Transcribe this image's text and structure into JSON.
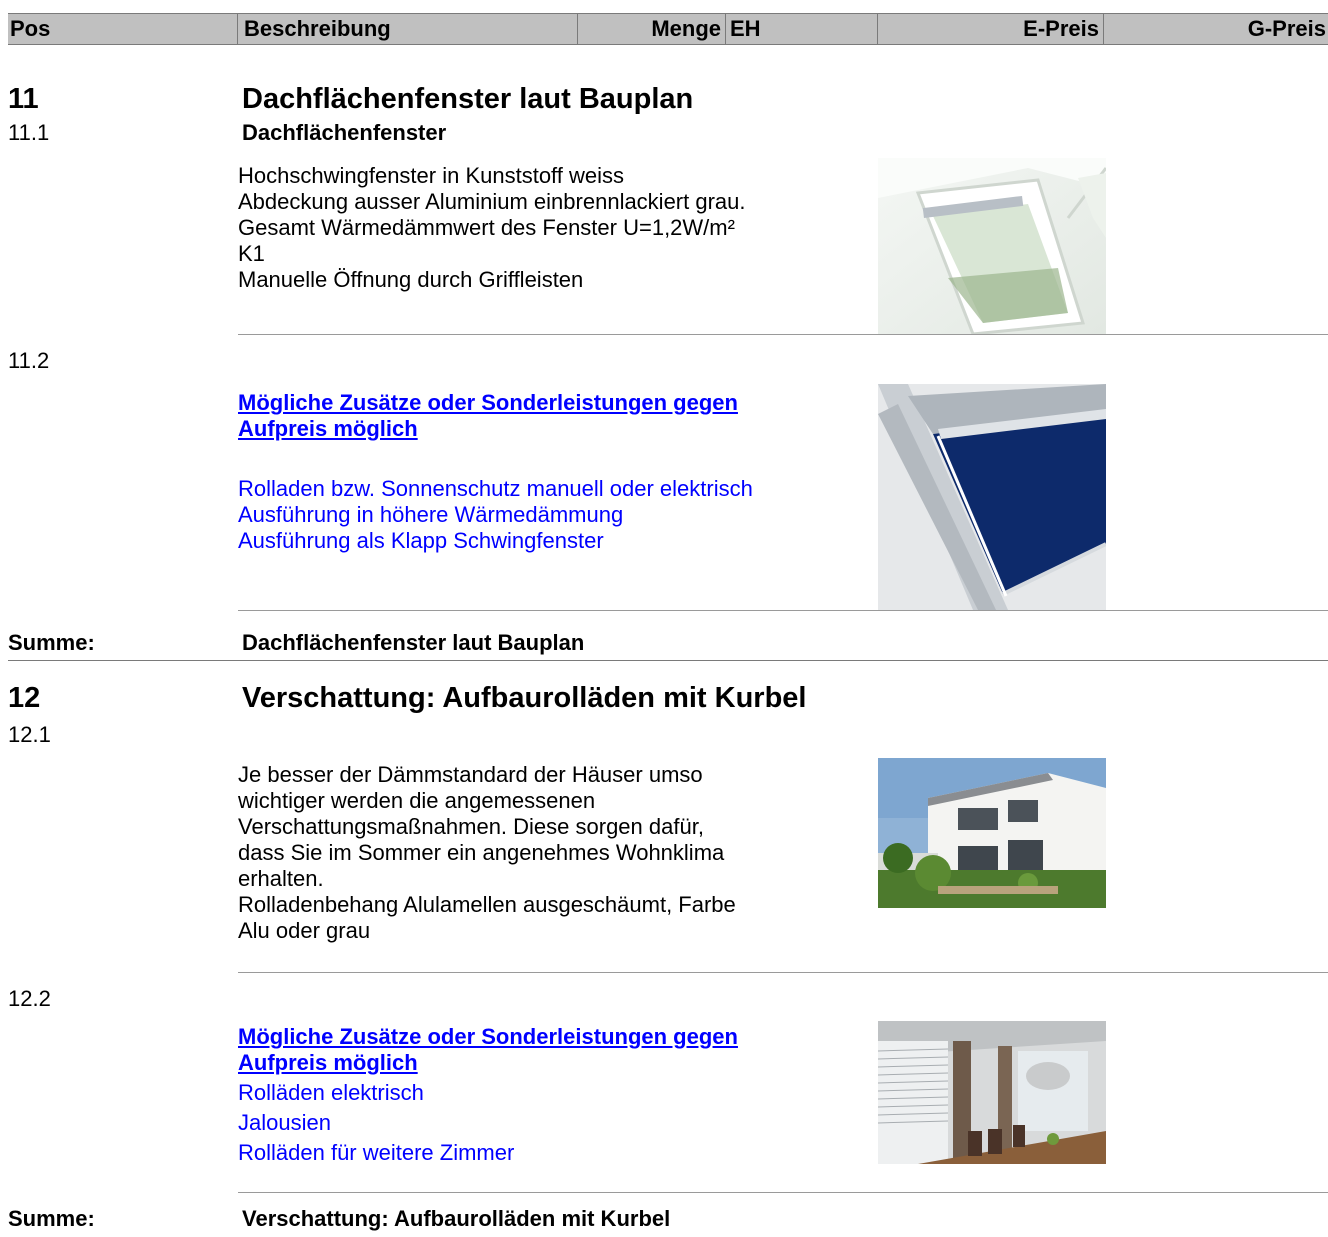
{
  "header": {
    "pos": "Pos",
    "beschreibung": "Beschreibung",
    "menge": "Menge",
    "eh": "EH",
    "epreis": "E-Preis",
    "gpreis": "G-Preis"
  },
  "section11": {
    "number": "11",
    "title": "Dachflächenfenster laut Bauplan",
    "item1": {
      "pos": "11.1",
      "title": "Dachflächenfenster",
      "lines": [
        "Hochschwingfenster in Kunststoff weiss",
        "Abdeckung ausser Aluminium einbrennlackiert grau.",
        "Gesamt Wärmedämmwert des Fenster U=1,2W/m²",
        "K1",
        "Manuelle Öffnung durch Griffleisten"
      ]
    },
    "item2": {
      "pos": "11.2",
      "link_line1": "Mögliche Zusätze oder Sonderleistungen gegen",
      "link_line2": "Aufpreis möglich",
      "lines": [
        "Rolladen bzw. Sonnenschutz manuell oder elektrisch",
        "Ausführung in höhere Wärmedämmung",
        "Ausführung als Klapp Schwingfenster"
      ]
    },
    "sum_label": "Summe:",
    "sum_title": "Dachflächenfenster laut Bauplan"
  },
  "section12": {
    "number": "12",
    "title": "Verschattung: Aufbaurolläden mit Kurbel",
    "item1": {
      "pos": "12.1",
      "lines": [
        "Je besser der Dämmstandard der Häuser umso",
        "wichtiger werden die angemessenen",
        "Verschattungsmaßnahmen. Diese sorgen dafür,",
        "dass Sie im Sommer ein angenehmes Wohnklima",
        "erhalten.",
        "Rolladenbehang Alulamellen ausgeschäumt, Farbe",
        "Alu oder grau"
      ]
    },
    "item2": {
      "pos": "12.2",
      "link_line1": "Mögliche Zusätze oder Sonderleistungen gegen",
      "link_line2": "Aufpreis möglich",
      "lines": [
        "Rolläden elektrisch",
        "Jalousien",
        "Rolläden für weitere Zimmer"
      ]
    },
    "sum_label": "Summe:",
    "sum_title": "Verschattung: Aufbaurolläden mit Kurbel"
  },
  "colors": {
    "header_bg": "#c0c0c0",
    "link": "#0000ff",
    "rule": "#9a9a9a"
  }
}
